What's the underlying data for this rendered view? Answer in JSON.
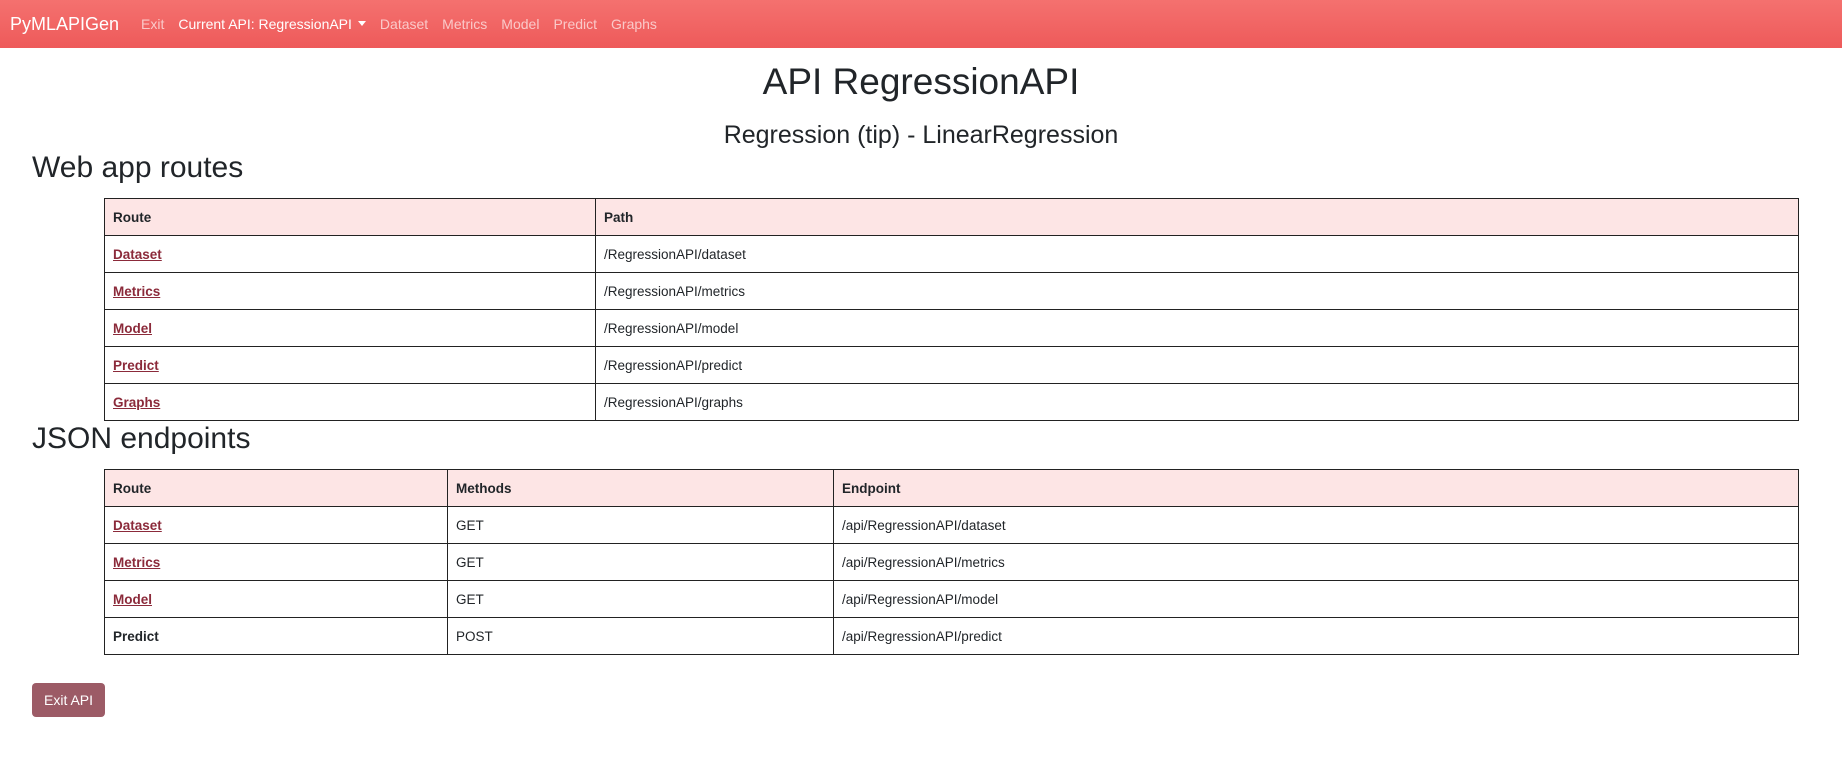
{
  "navbar": {
    "brand": "PyMLAPIGen",
    "exit": "Exit",
    "current_api": "Current API: RegressionAPI",
    "links": [
      "Dataset",
      "Metrics",
      "Model",
      "Predict",
      "Graphs"
    ]
  },
  "header": {
    "title": "API RegressionAPI",
    "subtitle": "Regression (tip) - LinearRegression"
  },
  "web_routes": {
    "heading": "Web app routes",
    "columns": [
      "Route",
      "Path"
    ],
    "rows": [
      {
        "route": "Dataset",
        "path": "/RegressionAPI/dataset"
      },
      {
        "route": "Metrics",
        "path": "/RegressionAPI/metrics"
      },
      {
        "route": "Model",
        "path": "/RegressionAPI/model"
      },
      {
        "route": "Predict",
        "path": "/RegressionAPI/predict"
      },
      {
        "route": "Graphs",
        "path": "/RegressionAPI/graphs"
      }
    ]
  },
  "json_endpoints": {
    "heading": "JSON endpoints",
    "columns": [
      "Route",
      "Methods",
      "Endpoint"
    ],
    "rows": [
      {
        "route": "Dataset",
        "methods": "GET",
        "endpoint": "/api/RegressionAPI/dataset"
      },
      {
        "route": "Metrics",
        "methods": "GET",
        "endpoint": "/api/RegressionAPI/metrics"
      },
      {
        "route": "Model",
        "methods": "GET",
        "endpoint": "/api/RegressionAPI/model"
      },
      {
        "route": "Predict",
        "methods": "POST",
        "endpoint": "/api/RegressionAPI/predict"
      }
    ]
  },
  "footer": {
    "exit_button": "Exit API"
  },
  "colors": {
    "navbar": "#ee5a5a",
    "table_header": "#fde5e5",
    "link": "#8b2a3a",
    "exit_button": "#9c5b66"
  }
}
